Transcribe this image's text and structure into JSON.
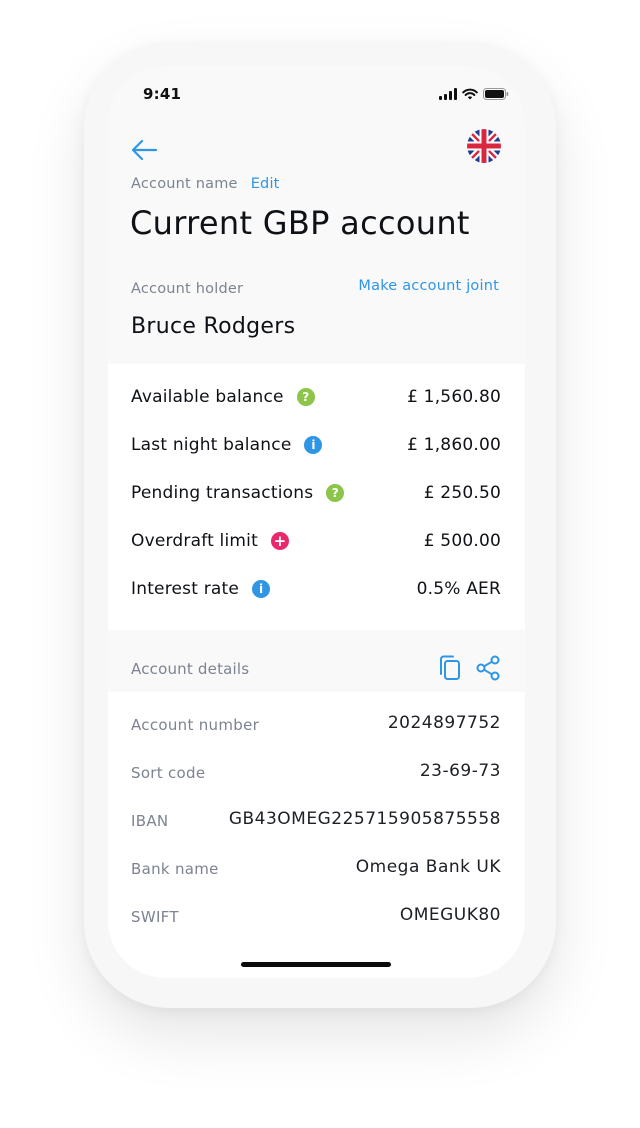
{
  "status_bar": {
    "time": "9:41",
    "icons": [
      "signal-icon",
      "wifi-icon",
      "battery-icon"
    ]
  },
  "header": {
    "back_icon": "arrow-left-icon",
    "flag_icon": "uk-flag-icon",
    "account_name_label": "Account name",
    "edit_label": "Edit",
    "title": "Current GBP account"
  },
  "holder": {
    "label": "Account holder",
    "make_joint_label": "Make account joint",
    "name": "Bruce Rodgers"
  },
  "balances": [
    {
      "label": "Available balance",
      "icon": "help-icon",
      "icon_color": "#8dc54b",
      "glyph": "?",
      "value": "£ 1,560.80"
    },
    {
      "label": "Last night balance",
      "icon": "info-icon",
      "icon_color": "#2f96e6",
      "glyph": "i",
      "value": "£ 1,860.00"
    },
    {
      "label": "Pending transactions",
      "icon": "help-icon",
      "icon_color": "#8dc54b",
      "glyph": "?",
      "value": "£ 250.50"
    },
    {
      "label": "Overdraft limit",
      "icon": "plus-icon",
      "icon_color": "#e82a6c",
      "glyph": "+",
      "value": "£ 500.00"
    },
    {
      "label": "Interest rate",
      "icon": "info-icon",
      "icon_color": "#2f96e6",
      "glyph": "i",
      "value": "0.5% AER"
    }
  ],
  "details": {
    "header_label": "Account details",
    "copy_icon": "copy-icon",
    "share_icon": "share-icon",
    "rows": [
      {
        "label": "Account number",
        "value": "2024897752"
      },
      {
        "label": "Sort code",
        "value": "23-69-73"
      },
      {
        "label": "IBAN",
        "value": "GB43OMEG225715905875558"
      },
      {
        "label": "Bank name",
        "value": "Omega Bank UK"
      },
      {
        "label": "SWIFT",
        "value": "OMEGUK80"
      }
    ]
  },
  "colors": {
    "accent": "#2f96e6",
    "text": "#0e1116",
    "muted": "#7c8391",
    "green": "#8dc54b",
    "pink": "#e82a6c"
  }
}
